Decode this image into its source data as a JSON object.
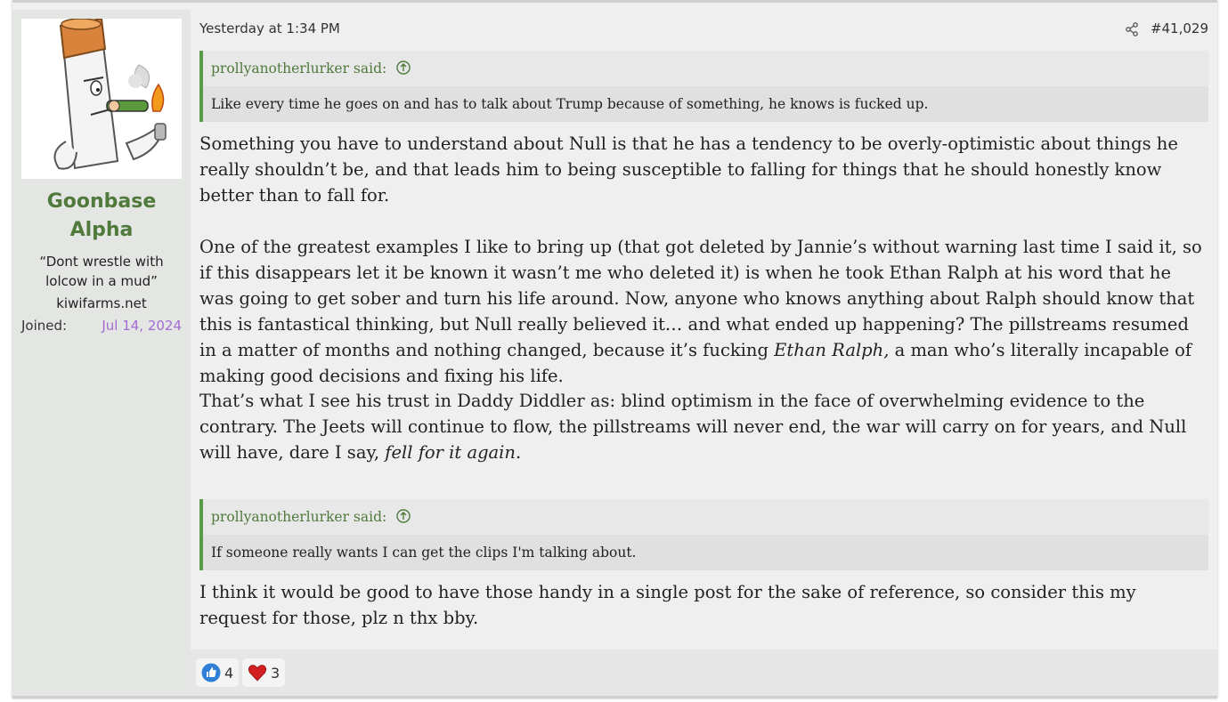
{
  "user": {
    "name_line1": "Goonbase",
    "name_line2": "Alpha",
    "title_line1": "“Dont wrestle with",
    "title_line2": "lolcow in a mud”",
    "banner": "kiwifarms.net",
    "joined_label": "Joined:",
    "joined_date": "Jul 14, 2024"
  },
  "post": {
    "timestamp": "Yesterday at 1:34 PM",
    "number": "#41,029",
    "quote1": {
      "author": "prollyanotherlurker said:",
      "text": "Like every time he goes on and has to talk about Trump because of something, he knows is fucked up."
    },
    "para1": "Something you have to understand about Null is that he has a tendency to be overly-optimistic about things he really shouldn’t be, and that leads him to being susceptible to falling for things that he should honestly know better than to fall for.",
    "para2_start": "One of the greatest examples I like to bring up (that got deleted by Jannie’s without warning last time I said it, so if this disappears let it be known it wasn’t me who deleted it) is when he took Ethan Ralph at his word that he was going to get sober and turn his life around. Now, anyone who knows anything about Ralph should know that this is fantastical thinking, but Null really believed it… and what ended up happening? The pillstreams resumed in a matter of months and nothing changed, because it’s fucking ",
    "para2_italic": "Ethan Ralph,",
    "para2_end": " a man who’s literally incapable of making good decisions and fixing his life.",
    "para3_start": "That’s what I see his trust in Daddy Diddler as: blind optimism in the face of overwhelming evidence to the contrary. The Jeets will continue to flow, the pillstreams will never end, the war will carry on for years, and Null will have, dare I say, ",
    "para3_italic": "fell for it again",
    "para3_end": ".",
    "quote2": {
      "author": "prollyanotherlurker said:",
      "text": "If someone really wants I can get the clips I'm talking about."
    },
    "para4": "I think it would be good to have those handy in a single post for the sake of reference, so consider this my request for those, plz n thx bby."
  },
  "reactions": [
    {
      "icon": "thumbs-up-icon",
      "count": "4"
    },
    {
      "icon": "heart-icon",
      "count": "3"
    }
  ],
  "colors": {
    "accent_green": "#5b9a47",
    "username_green": "#4f7a3c",
    "joined_purple": "#a36bd3",
    "thumbs_blue": "#2f7fd6",
    "heart_red": "#d42020"
  }
}
